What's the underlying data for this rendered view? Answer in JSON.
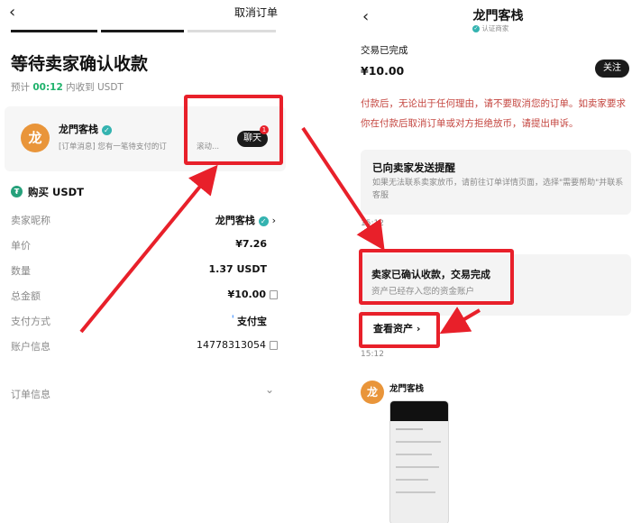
{
  "left": {
    "header": {
      "back_icon": "chevron-left-icon",
      "cancel_order": "取消订单"
    },
    "title": "等待卖家确认收款",
    "eta": {
      "prefix": "预计",
      "time": "00:12",
      "suffix": "内收到 USDT"
    },
    "chat_card": {
      "avatar_char": "龙",
      "seller_name": "龙門客栈",
      "message": "[订单消息] 您有一笔待支付的订",
      "message_tail": "滚动...",
      "chat_button": "聊天",
      "badge": "1"
    },
    "buy_section": {
      "icon": "tether-icon",
      "title": "购买 USDT"
    },
    "details": [
      {
        "label": "卖家昵称",
        "value": "龙門客栈"
      },
      {
        "label": "单价",
        "value": "¥7.26"
      },
      {
        "label": "数量",
        "value": "1.37 USDT"
      },
      {
        "label": "总金额",
        "value": "¥10.00"
      },
      {
        "label": "支付方式",
        "value": "支付宝"
      },
      {
        "label": "账户信息",
        "value": "14778313054"
      }
    ],
    "order_info": "订单信息"
  },
  "right": {
    "header": {
      "title": "龙門客栈",
      "verified": "认证商家"
    },
    "status": "交易已完成",
    "amount": "¥10.00",
    "follow_button": "关注",
    "warning": "付款后，无论出于任何理由，请不要取消您的订单。如卖家要求你在付款后取消订单或对方拒绝放币，请提出申诉。",
    "reminder": {
      "title": "已向卖家发送提醒",
      "body": "如果无法联系卖家放币，请前往订单详情页面，选择\"需要帮助\"并联系客服"
    },
    "time1": "15:12",
    "confirmed": {
      "title": "卖家已确认收款，交易完成",
      "body": "资产已经存入您的资金账户"
    },
    "view_assets": "查看资产",
    "time2": "15:12",
    "chat": {
      "avatar_char": "龙",
      "name": "龙門客栈"
    }
  },
  "colors": {
    "annotation_red": "#e8202a",
    "accent_green": "#20b26c",
    "warning_red": "#c4453f"
  }
}
